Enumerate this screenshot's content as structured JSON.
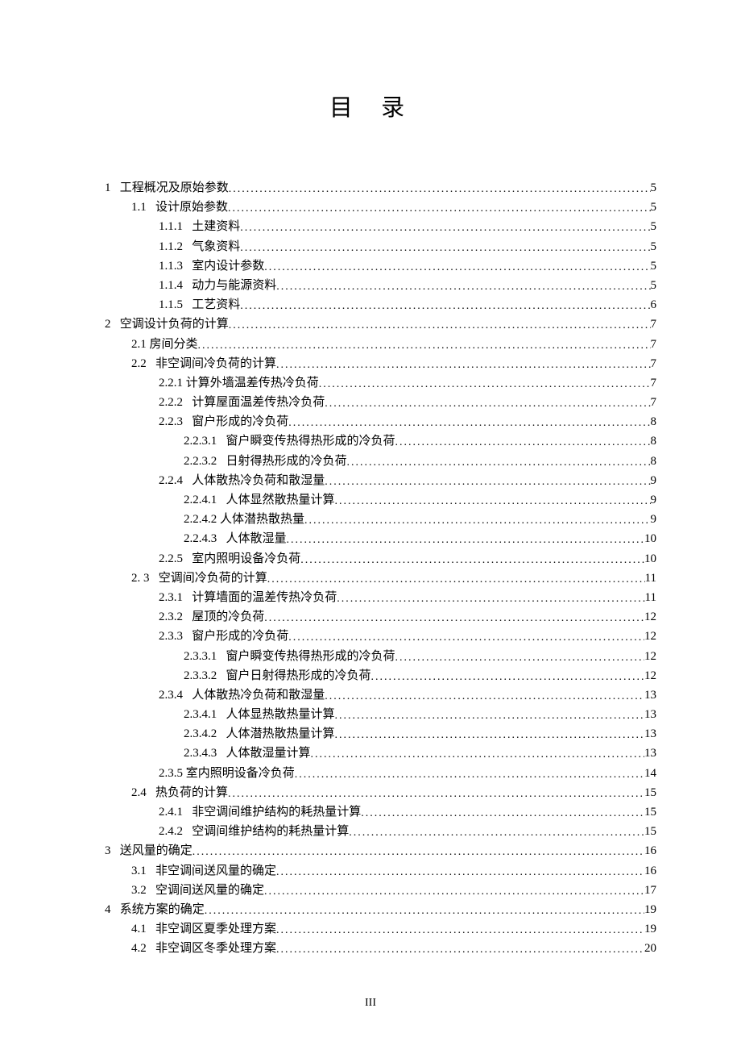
{
  "title": "目 录",
  "footer": "III",
  "toc": [
    {
      "level": 0,
      "num": "1",
      "text": "工程概况及原始参数",
      "page": "5",
      "gap": "wide"
    },
    {
      "level": 1,
      "num": "1.1",
      "text": "设计原始参数",
      "page": "5",
      "gap": "wide"
    },
    {
      "level": 2,
      "num": "1.1.1",
      "text": "土建资料",
      "page": "5",
      "gap": "wide"
    },
    {
      "level": 2,
      "num": "1.1.2",
      "text": "气象资料",
      "page": "5",
      "gap": "wide"
    },
    {
      "level": 2,
      "num": "1.1.3",
      "text": "室内设计参数",
      "page": "5",
      "gap": "wide"
    },
    {
      "level": 2,
      "num": "1.1.4",
      "text": "动力与能源资料",
      "page": "5",
      "gap": "wide"
    },
    {
      "level": 2,
      "num": "1.1.5",
      "text": "工艺资料",
      "page": "6",
      "gap": "wide"
    },
    {
      "level": 0,
      "num": "2",
      "text": "空调设计负荷的计算",
      "page": "7",
      "gap": "wide"
    },
    {
      "level": 1,
      "num": "2.1",
      "text": "房间分类",
      "page": "7",
      "gap": "sm"
    },
    {
      "level": 1,
      "num": "2.2",
      "text": "非空调间冷负荷的计算",
      "page": "7",
      "gap": "wide"
    },
    {
      "level": 2,
      "num": "2.2.1",
      "text": "计算外墙温差传热冷负荷",
      "page": "7",
      "gap": "sm"
    },
    {
      "level": 2,
      "num": "2.2.2",
      "text": "计算屋面温差传热冷负荷",
      "page": "7",
      "gap": "wide"
    },
    {
      "level": 2,
      "num": "2.2.3",
      "text": "窗户形成的冷负荷",
      "page": "8",
      "gap": "wide"
    },
    {
      "level": 3,
      "num": "2.2.3.1",
      "text": "窗户瞬变传热得热形成的冷负荷",
      "page": "8",
      "gap": "wide"
    },
    {
      "level": 3,
      "num": "2.2.3.2",
      "text": "日射得热形成的冷负荷",
      "page": "8",
      "gap": "wide"
    },
    {
      "level": 2,
      "num": "2.2.4",
      "text": "人体散热冷负荷和散湿量",
      "page": "9",
      "gap": "wide"
    },
    {
      "level": 3,
      "num": "2.2.4.1",
      "text": "人体显然散热量计算",
      "page": "9",
      "gap": "wide"
    },
    {
      "level": 3,
      "num": "2.2.4.2",
      "text": "人体潜热散热量",
      "page": "9",
      "gap": "sm"
    },
    {
      "level": 3,
      "num": "2.2.4.3",
      "text": "人体散湿量",
      "page": "10",
      "gap": "wide"
    },
    {
      "level": 2,
      "num": "2.2.5",
      "text": "室内照明设备冷负荷",
      "page": "10",
      "gap": "wide"
    },
    {
      "level": 1,
      "num": "2. 3",
      "text": "空调间冷负荷的计算",
      "page": "11",
      "gap": "wide"
    },
    {
      "level": 2,
      "num": "2.3.1",
      "text": "计算墙面的温差传热冷负荷",
      "page": "11",
      "gap": "wide"
    },
    {
      "level": 2,
      "num": "2.3.2",
      "text": "屋顶的冷负荷",
      "page": "12",
      "gap": "wide"
    },
    {
      "level": 2,
      "num": "2.3.3",
      "text": "窗户形成的冷负荷",
      "page": "12",
      "gap": "wide"
    },
    {
      "level": 3,
      "num": "2.3.3.1",
      "text": "窗户瞬变传热得热形成的冷负荷",
      "page": "12",
      "gap": "wide"
    },
    {
      "level": 3,
      "num": "2.3.3.2",
      "text": "窗户日射得热形成的冷负荷",
      "page": "12",
      "gap": "wide"
    },
    {
      "level": 2,
      "num": "2.3.4",
      "text": "人体散热冷负荷和散湿量",
      "page": "13",
      "gap": "wide"
    },
    {
      "level": 3,
      "num": "2.3.4.1",
      "text": "人体显热散热量计算",
      "page": "13",
      "gap": "wide"
    },
    {
      "level": 3,
      "num": "2.3.4.2",
      "text": "人体潜热散热量计算",
      "page": "13",
      "gap": "wide"
    },
    {
      "level": 3,
      "num": "2.3.4.3",
      "text": "人体散湿量计算",
      "page": "13",
      "gap": "wide"
    },
    {
      "level": 2,
      "num": "2.3.5",
      "text": "室内照明设备冷负荷",
      "page": "14",
      "gap": "sm"
    },
    {
      "level": 1,
      "num": "2.4",
      "text": "热负荷的计算",
      "page": "15",
      "gap": "wide"
    },
    {
      "level": 2,
      "num": "2.4.1",
      "text": "非空调间维护结构的耗热量计算",
      "page": "15",
      "gap": "wide"
    },
    {
      "level": 2,
      "num": "2.4.2",
      "text": "空调间维护结构的耗热量计算",
      "page": "15",
      "gap": "wide"
    },
    {
      "level": 0,
      "num": "3",
      "text": "送风量的确定",
      "page": "16",
      "gap": "wide"
    },
    {
      "level": 1,
      "num": "3.1",
      "text": "非空调间送风量的确定",
      "page": "16",
      "gap": "wide"
    },
    {
      "level": 1,
      "num": "3.2",
      "text": "空调间送风量的确定",
      "page": "17",
      "gap": "wide"
    },
    {
      "level": 0,
      "num": "4",
      "text": "系统方案的确定",
      "page": "19",
      "gap": "wide"
    },
    {
      "level": 1,
      "num": "4.1",
      "text": "非空调区夏季处理方案",
      "page": "19",
      "gap": "wide"
    },
    {
      "level": 1,
      "num": "4.2",
      "text": "非空调区冬季处理方案",
      "page": "20",
      "gap": "wide"
    }
  ]
}
